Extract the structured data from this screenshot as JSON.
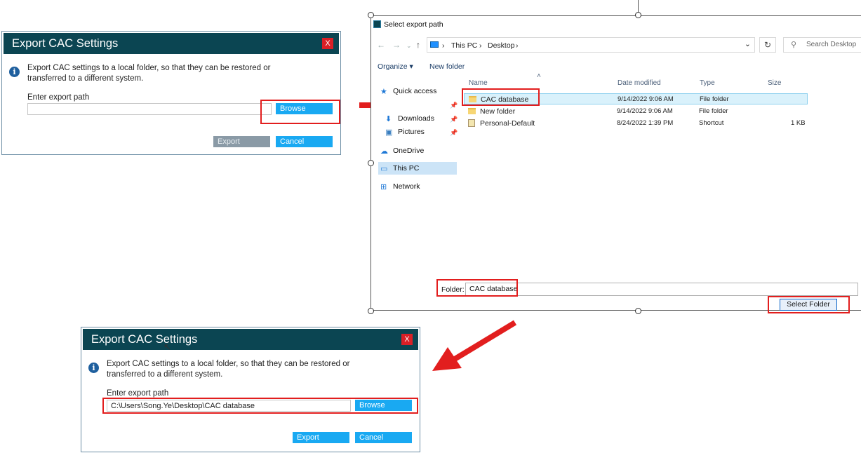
{
  "dialog1": {
    "title": "Export CAC Settings",
    "close": "X",
    "message": "Export CAC settings to a local folder, so that they can be restored or transferred to a different system.",
    "path_label": "Enter export path",
    "path_value": "",
    "browse": "Browse",
    "export": "Export",
    "cancel": "Cancel"
  },
  "dialog2": {
    "title": "Export CAC Settings",
    "close": "X",
    "message": "Export CAC settings to a local folder, so that they can be restored or transferred to a different system.",
    "path_label": "Enter export path",
    "path_value": "C:\\Users\\Song.Ye\\Desktop\\CAC database",
    "browse": "Browse",
    "export": "Export",
    "cancel": "Cancel"
  },
  "explorer": {
    "title": "Select export path",
    "address": [
      "This PC",
      "Desktop"
    ],
    "search_placeholder": "Search Desktop",
    "organize": "Organize",
    "new_folder": "New folder",
    "nav": {
      "quick_access": "Quick access",
      "downloads": "Downloads",
      "pictures": "Pictures",
      "onedrive": "OneDrive",
      "this_pc": "This PC",
      "network": "Network"
    },
    "columns": {
      "name": "Name",
      "date": "Date modified",
      "type": "Type",
      "size": "Size"
    },
    "files": [
      {
        "name": "CAC database",
        "date": "9/14/2022 9:06 AM",
        "type": "File folder",
        "size": ""
      },
      {
        "name": "New folder",
        "date": "9/14/2022 9:06 AM",
        "type": "File folder",
        "size": ""
      },
      {
        "name": "Personal-Default",
        "date": "8/24/2022 1:39 PM",
        "type": "Shortcut",
        "size": "1 KB"
      }
    ],
    "folder_label": "Folder:",
    "folder_value": "CAC database",
    "select_folder": "Select Folder"
  },
  "colors": {
    "titlebar": "#0b4552",
    "accent_blue": "#19a9f2",
    "highlight_red": "#e21e1e"
  }
}
